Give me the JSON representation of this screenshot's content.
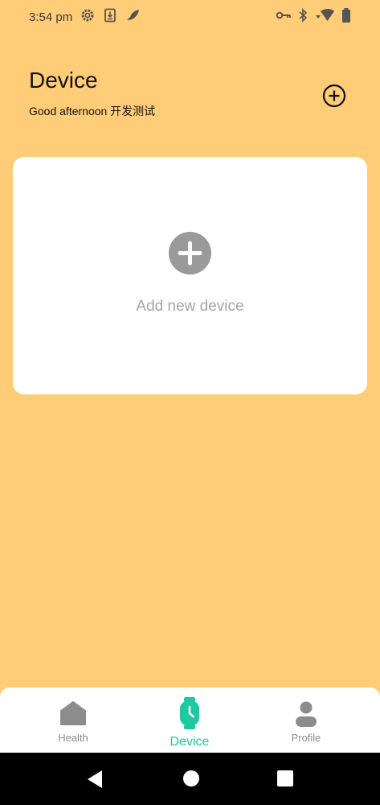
{
  "status_bar": {
    "time": "3:54 pm",
    "left_icons": [
      "settings-gear-icon",
      "download-icon",
      "feather-icon"
    ],
    "right_icons": [
      "vpn-key-icon",
      "bluetooth-icon",
      "wifi-icon",
      "battery-icon"
    ]
  },
  "header": {
    "title": "Device",
    "greeting": "Good afternoon 开发测试",
    "add_icon": "add-circle-outline-icon"
  },
  "card": {
    "label": "Add new device",
    "icon": "add-circle-icon"
  },
  "bottom_nav": {
    "items": [
      {
        "label": "Health",
        "icon": "home-icon",
        "active": false
      },
      {
        "label": "Device",
        "icon": "watch-icon",
        "active": true
      },
      {
        "label": "Profile",
        "icon": "person-icon",
        "active": false
      }
    ],
    "active_color": "#1EC9A0",
    "inactive_color": "#8C8C8C"
  },
  "system_nav": {
    "buttons": [
      "back-icon",
      "home-circle-icon",
      "recents-icon"
    ]
  },
  "colors": {
    "background": "#FFCC77",
    "card": "#FFFFFF",
    "accent": "#1EC9A0"
  }
}
